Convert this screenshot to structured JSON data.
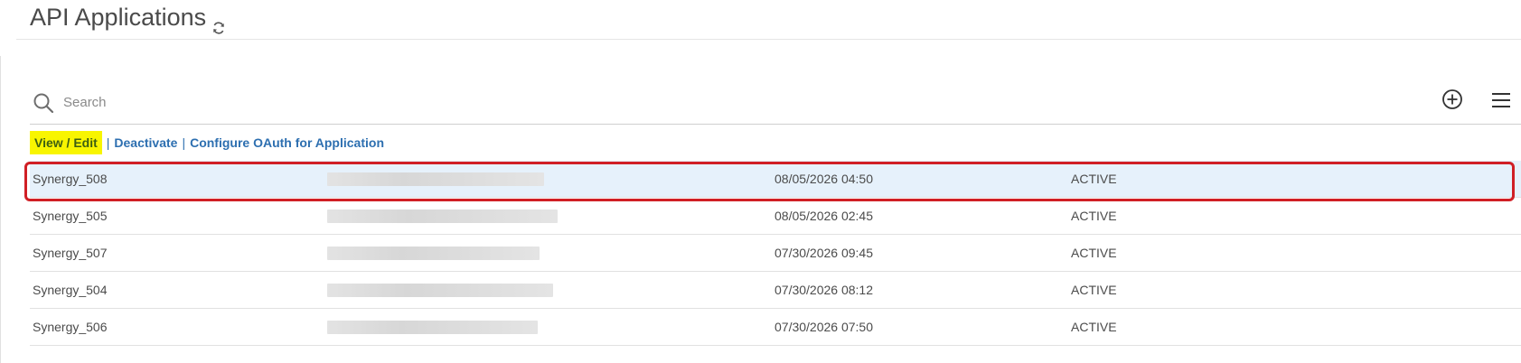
{
  "header": {
    "title": "API Applications",
    "refresh_icon": "refresh-icon"
  },
  "search": {
    "placeholder": "Search",
    "value": ""
  },
  "toolbar": {
    "add_icon": "plus-circle-icon",
    "menu_icon": "hamburger-menu-icon"
  },
  "actions": {
    "view_edit": "View / Edit",
    "deactivate": "Deactivate",
    "configure_oauth": "Configure OAuth for Application",
    "separator": "|"
  },
  "table": {
    "rows": [
      {
        "name": "Synergy_508",
        "key": "",
        "created": "08/05/2026 04:50",
        "status": "ACTIVE",
        "selected": true
      },
      {
        "name": "Synergy_505",
        "key": "",
        "created": "08/05/2026 02:45",
        "status": "ACTIVE",
        "selected": false
      },
      {
        "name": "Synergy_507",
        "key": "",
        "created": "07/30/2026 09:45",
        "status": "ACTIVE",
        "selected": false
      },
      {
        "name": "Synergy_504",
        "key": "",
        "created": "07/30/2026 08:12",
        "status": "ACTIVE",
        "selected": false
      },
      {
        "name": "Synergy_506",
        "key": "",
        "created": "07/30/2026 07:50",
        "status": "ACTIVE",
        "selected": false
      }
    ]
  },
  "colors": {
    "accent_link": "#2d6fb0",
    "highlight": "#f8f500",
    "selected_row": "#e6f1fb",
    "selection_outline": "#d01f25"
  }
}
